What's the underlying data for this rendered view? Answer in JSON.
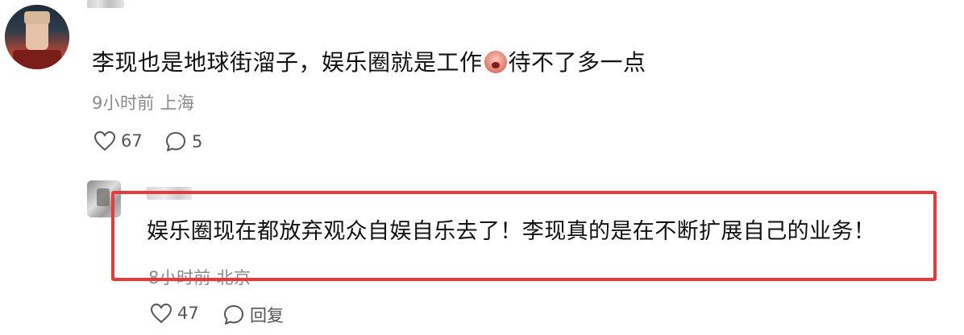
{
  "main_comment": {
    "text_before_emoji": "李现也是地球街溜子，娱乐圈就是工作",
    "emoji": "face-emoji",
    "text_after_emoji": "待不了多一点",
    "time": "9小时前",
    "location": "上海",
    "likes": "67",
    "replies": "5"
  },
  "reply": {
    "text": "娱乐圈现在都放弃观众自娱自乐去了！李现真的是在不断扩展自己的业务！",
    "time": "8小时前",
    "location": "北京",
    "likes": "47",
    "reply_label": "回复"
  },
  "colors": {
    "highlight_border": "#e83a3a",
    "meta_text": "#8a8a8a"
  }
}
